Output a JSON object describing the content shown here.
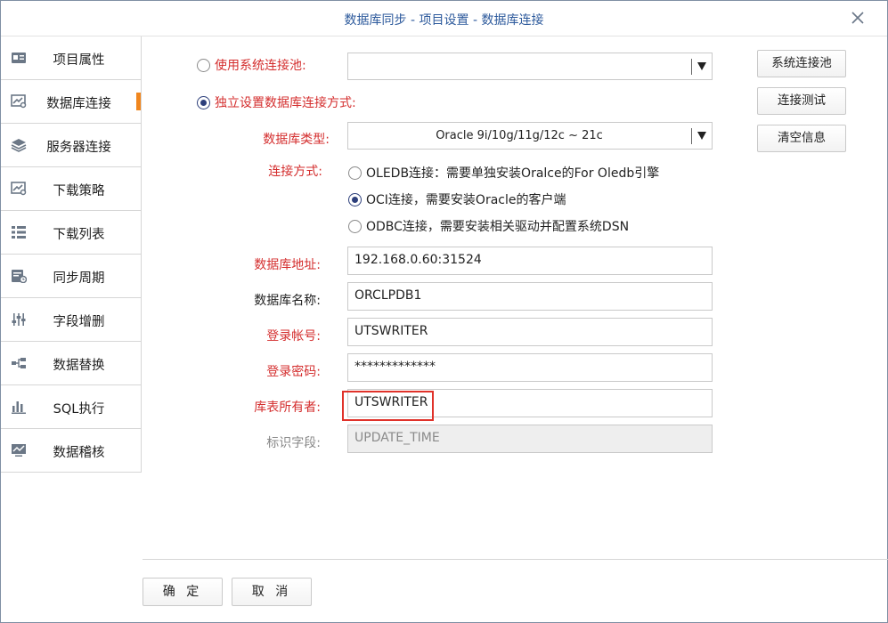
{
  "window": {
    "title": "数据库同步 - 项目设置 - 数据库连接"
  },
  "sidebar": {
    "items": [
      {
        "label": "项目属性",
        "icon": "card-icon"
      },
      {
        "label": "数据库连接",
        "icon": "chart-search-icon",
        "active": true
      },
      {
        "label": "服务器连接",
        "icon": "layers-icon"
      },
      {
        "label": "下载策略",
        "icon": "chart-search-icon"
      },
      {
        "label": "下载列表",
        "icon": "list-icon"
      },
      {
        "label": "同步周期",
        "icon": "calendar-icon"
      },
      {
        "label": "字段增删",
        "icon": "sliders-icon"
      },
      {
        "label": "数据替换",
        "icon": "swap-icon"
      },
      {
        "label": "SQL执行",
        "icon": "bar-chart-icon"
      },
      {
        "label": "数据稽核",
        "icon": "monitor-chart-icon"
      }
    ]
  },
  "conn_mode": {
    "system_pool_label": "使用系统连接池:",
    "system_pool_value": "",
    "independent_label": "独立设置数据库连接方式:"
  },
  "db_type": {
    "label": "数据库类型:",
    "value": "Oracle 9i/10g/11g/12c ~ 21c"
  },
  "connect_method": {
    "label": "连接方式:",
    "options": [
      "OLEDB连接：需要单独安装Oralce的For Oledb引擎",
      "OCI连接，需要安装Oracle的客户端",
      "ODBC连接，需要安装相关驱动并配置系统DSN"
    ],
    "selected_index": 1
  },
  "fields": {
    "address": {
      "label": "数据库地址:",
      "value": "192.168.0.60:31524"
    },
    "name": {
      "label": "数据库名称:",
      "value": "ORCLPDB1"
    },
    "account": {
      "label": "登录帐号:",
      "value": "UTSWRITER"
    },
    "password": {
      "label": "登录密码:",
      "value": "*************"
    },
    "owner": {
      "label": "库表所有者:",
      "value": "UTSWRITER"
    },
    "id_field": {
      "label": "标识字段:",
      "value": "UPDATE_TIME"
    }
  },
  "side_buttons": {
    "pool": "系统连接池",
    "test": "连接测试",
    "clear": "清空信息"
  },
  "footer": {
    "ok": "确 定",
    "cancel": "取 消"
  },
  "colors": {
    "required": "#d42e2e",
    "accent": "#f0861e",
    "title": "#2d5a9c",
    "highlight": "#e0322a"
  }
}
